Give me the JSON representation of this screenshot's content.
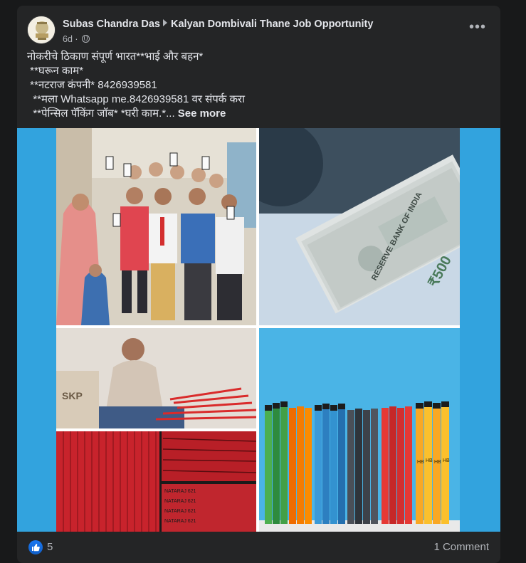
{
  "post": {
    "author": "Subas Chandra Das",
    "group": "Kalyan Dombivali Thane Job Opportunity",
    "time": "6d",
    "dot": "·",
    "privacy_icon": "globe-icon",
    "more_icon": "more-options-icon",
    "more_label": "•••",
    "text_lines": [
      "नोकरीचे ठिकाण संपूर्ण भारत**भाई और बहन*",
      " **घरून काम*",
      " **नटराज कंपनी* 8426939581",
      "  **मला Whatsapp me.8426939581 वर संपर्क करा",
      "  **पेन्सिल पॅकिंग जॉब* *घरी काम.*..."
    ],
    "see_more": "See more"
  },
  "photo_labels": {
    "pencil_label": "NATARAJ 621",
    "banknote_bank": "RESERVE BANK OF INDIA",
    "banknote_value": "₹500",
    "pencil_grade": "HB",
    "box_label": "SKP"
  },
  "footer": {
    "like_icon": "like-icon",
    "reactions": "5",
    "comments": "1 Comment"
  },
  "colors": {
    "card_bg": "#242526",
    "page_bg": "#18191a",
    "media_bg": "#32a3de",
    "text": "#e4e6eb",
    "muted": "#b0b3b8",
    "accent": "#1877f2"
  }
}
